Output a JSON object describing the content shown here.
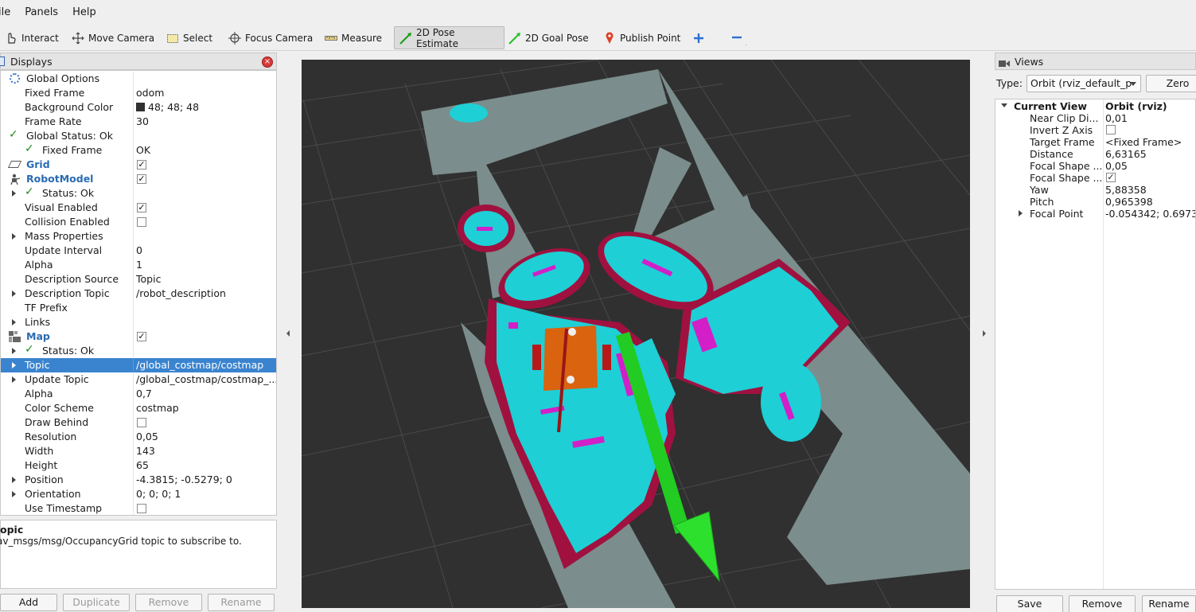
{
  "menu": {
    "file": "ile",
    "panels": "Panels",
    "help": "Help"
  },
  "toolbar": {
    "interact": "Interact",
    "move_camera": "Move Camera",
    "select": "Select",
    "focus_camera": "Focus Camera",
    "measure": "Measure",
    "pose_estimate": "2D Pose Estimate",
    "goal_pose": "2D Goal Pose",
    "publish_point": "Publish Point"
  },
  "displays": {
    "title": "Displays",
    "rows": [
      {
        "name": "Global Options",
        "value": ""
      },
      {
        "name": "Fixed Frame",
        "value": "odom"
      },
      {
        "name": "Background Color",
        "value": "48; 48; 48"
      },
      {
        "name": "Frame Rate",
        "value": "30"
      },
      {
        "name": "Global Status: Ok",
        "value": ""
      },
      {
        "name": "Fixed Frame",
        "value": "OK"
      },
      {
        "name": "Grid",
        "value": ""
      },
      {
        "name": "RobotModel",
        "value": ""
      },
      {
        "name": "Status: Ok",
        "value": ""
      },
      {
        "name": "Visual Enabled",
        "value": ""
      },
      {
        "name": "Collision Enabled",
        "value": ""
      },
      {
        "name": "Mass Properties",
        "value": ""
      },
      {
        "name": "Update Interval",
        "value": "0"
      },
      {
        "name": "Alpha",
        "value": "1"
      },
      {
        "name": "Description Source",
        "value": "Topic"
      },
      {
        "name": "Description Topic",
        "value": "/robot_description"
      },
      {
        "name": "TF Prefix",
        "value": ""
      },
      {
        "name": "Links",
        "value": ""
      },
      {
        "name": "Map",
        "value": ""
      },
      {
        "name": "Status: Ok",
        "value": ""
      },
      {
        "name": "Topic",
        "value": "/global_costmap/costmap"
      },
      {
        "name": "Update Topic",
        "value": "/global_costmap/costmap_..."
      },
      {
        "name": "Alpha",
        "value": "0,7"
      },
      {
        "name": "Color Scheme",
        "value": "costmap"
      },
      {
        "name": "Draw Behind",
        "value": ""
      },
      {
        "name": "Resolution",
        "value": "0,05"
      },
      {
        "name": "Width",
        "value": "143"
      },
      {
        "name": "Height",
        "value": "65"
      },
      {
        "name": "Position",
        "value": "-4.3815; -0.5279; 0"
      },
      {
        "name": "Orientation",
        "value": "0; 0; 0; 1"
      },
      {
        "name": "Use Timestamp",
        "value": ""
      }
    ],
    "desc_title": "opic",
    "desc_body": "av_msgs/msg/OccupancyGrid topic to subscribe to.",
    "buttons": {
      "add": "Add",
      "duplicate": "Duplicate",
      "remove": "Remove",
      "rename": "Rename"
    }
  },
  "views": {
    "title": "Views",
    "type_label": "Type:",
    "type_value": "Orbit (rviz_default_p",
    "zero": "Zero",
    "current_view": "Current View",
    "current_view_type": "Orbit (rviz)",
    "props": [
      {
        "name": "Near Clip Di...",
        "value": "0,01"
      },
      {
        "name": "Invert Z Axis",
        "value": ""
      },
      {
        "name": "Target Frame",
        "value": "<Fixed Frame>"
      },
      {
        "name": "Distance",
        "value": "6,63165"
      },
      {
        "name": "Focal Shape ...",
        "value": "0,05"
      },
      {
        "name": "Focal Shape ...",
        "value": ""
      },
      {
        "name": "Yaw",
        "value": "5,88358"
      },
      {
        "name": "Pitch",
        "value": "0,965398"
      },
      {
        "name": "Focal Point",
        "value": "-0.054342; 0.6973..."
      }
    ],
    "buttons": {
      "save": "Save",
      "remove": "Remove",
      "rename": "Rename"
    }
  },
  "checks": {
    "checked": "✓",
    "status_tick": "✓"
  },
  "colors": {
    "background": "#303030",
    "selection": "#3a84cf",
    "costmap_cyan": "#1ecfd6",
    "costmap_magenta": "#d21fc7",
    "inflation": "#a0113f",
    "free": "#7a8c8b",
    "arrow": "#22cc22"
  }
}
